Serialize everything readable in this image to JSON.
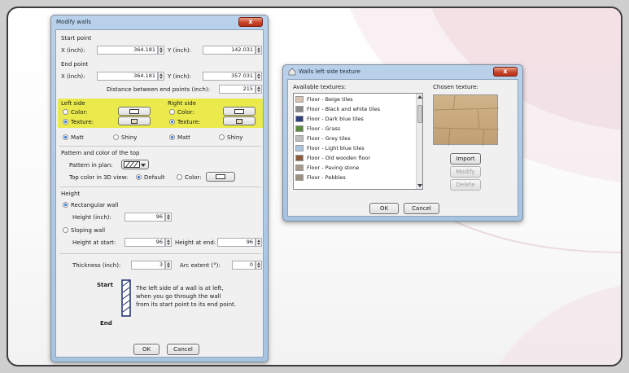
{
  "colors": {
    "highlight": "#eaea4c",
    "titlebar": "#a6c3e2",
    "close_button": "#c9442a",
    "preview_texture": "#c9aa7e"
  },
  "modify_walls": {
    "title": "Modify walls",
    "close_label": "x",
    "start_point_label": "Start point",
    "start_x_label": "X (inch):",
    "start_x_value": "364.181",
    "start_y_label": "Y (inch):",
    "start_y_value": "142.031",
    "end_point_label": "End point",
    "end_x_label": "X (inch):",
    "end_x_value": "364.181",
    "end_y_label": "Y (inch):",
    "end_y_value": "357.031",
    "distance_label": "Distance between end points (inch):",
    "distance_value": "215",
    "left_side_label": "Left side",
    "right_side_label": "Right side",
    "color_label": "Color:",
    "texture_label": "Texture:",
    "matt_label": "Matt",
    "shiny_label": "Shiny",
    "pattern_group_label": "Pattern and color of the top",
    "pattern_in_plan_label": "Pattern in plan:",
    "top_color_label": "Top color in 3D view:",
    "default_label": "Default",
    "top_color_color_label": "Color:",
    "height_group_label": "Height",
    "rectangular_wall_label": "Rectangular wall",
    "height_label": "Height (inch):",
    "height_value": "96",
    "sloping_wall_label": "Sloping wall",
    "height_at_start_label": "Height at start:",
    "height_at_start_value": "96",
    "height_at_end_label": "Height at end:",
    "height_at_end_value": "96",
    "thickness_label": "Thickness (inch):",
    "thickness_value": "3",
    "arc_extent_label": "Arc extent (°):",
    "arc_extent_value": "0",
    "start_word": "Start",
    "end_word": "End",
    "help_line1": "The left side of a wall is at left,",
    "help_line2": "when you go through the wall",
    "help_line3": "from its start point to its end point.",
    "ok_label": "OK",
    "cancel_label": "Cancel"
  },
  "texture_dialog": {
    "title": "Walls left side texture",
    "close_label": "x",
    "available_label": "Available textures:",
    "chosen_label": "Chosen texture:",
    "items": [
      {
        "label": "Floor - Beige tiles",
        "color": "#d9c3b0"
      },
      {
        "label": "Floor - Black and white tiles",
        "color": "#8a8a8a"
      },
      {
        "label": "Floor - Dark blue tiles",
        "color": "#2f3f7a"
      },
      {
        "label": "Floor - Grass",
        "color": "#5a8a3a"
      },
      {
        "label": "Floor - Grey tiles",
        "color": "#bdbdbd"
      },
      {
        "label": "Floor - Light blue tiles",
        "color": "#a8c4e0"
      },
      {
        "label": "Floor - Old wooden floor",
        "color": "#8a5a3a"
      },
      {
        "label": "Floor - Paving stone",
        "color": "#a79a8a"
      },
      {
        "label": "Floor - Pebbles",
        "color": "#9a9080"
      }
    ],
    "import_label": "Import",
    "modify_label": "Modify",
    "delete_label": "Delete",
    "ok_label": "OK",
    "cancel_label": "Cancel"
  }
}
